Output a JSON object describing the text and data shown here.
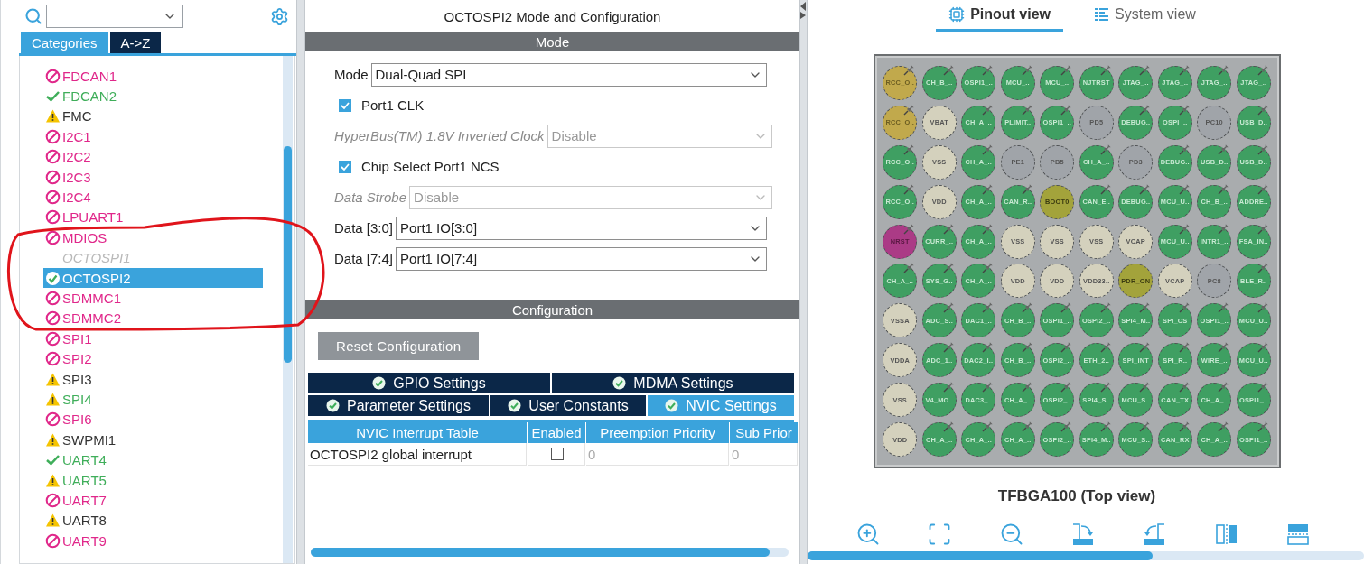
{
  "left_panel": {
    "tabs": [
      {
        "label": "Categories",
        "selected": true
      },
      {
        "label": "A->Z",
        "selected": false
      }
    ],
    "items": [
      {
        "label": "FDCAN1",
        "kind": "blocked",
        "selected": false
      },
      {
        "label": "FDCAN2",
        "kind": "configured",
        "selected": false
      },
      {
        "label": "FMC",
        "kind": "warning",
        "selected": false
      },
      {
        "label": "I2C1",
        "kind": "blocked",
        "selected": false
      },
      {
        "label": "I2C2",
        "kind": "blocked",
        "selected": false
      },
      {
        "label": "I2C3",
        "kind": "blocked",
        "selected": false
      },
      {
        "label": "I2C4",
        "kind": "blocked",
        "selected": false
      },
      {
        "label": "LPUART1",
        "kind": "blocked",
        "selected": false
      },
      {
        "label": "MDIOS",
        "kind": "blocked",
        "selected": false
      },
      {
        "label": "OCTOSPI1",
        "kind": "unavailable",
        "selected": false
      },
      {
        "label": "OCTOSPI2",
        "kind": "configured",
        "selected": true
      },
      {
        "label": "SDMMC1",
        "kind": "blocked",
        "selected": false
      },
      {
        "label": "SDMMC2",
        "kind": "blocked",
        "selected": false
      },
      {
        "label": "SPI1",
        "kind": "blocked",
        "selected": false
      },
      {
        "label": "SPI2",
        "kind": "blocked",
        "selected": false
      },
      {
        "label": "SPI3",
        "kind": "warning",
        "selected": false
      },
      {
        "label": "SPI4",
        "kind": "partial",
        "selected": false
      },
      {
        "label": "SPI6",
        "kind": "blocked",
        "selected": false
      },
      {
        "label": "SWPMI1",
        "kind": "warning",
        "selected": false
      },
      {
        "label": "UART4",
        "kind": "configured",
        "selected": false
      },
      {
        "label": "UART5",
        "kind": "partial",
        "selected": false
      },
      {
        "label": "UART7",
        "kind": "blocked",
        "selected": false
      },
      {
        "label": "UART8",
        "kind": "warning",
        "selected": false
      },
      {
        "label": "UART9",
        "kind": "blocked",
        "selected": false
      }
    ]
  },
  "middle_panel": {
    "title": "OCTOSPI2 Mode and Configuration",
    "mode_header": "Mode",
    "mode_fields": [
      {
        "kind": "select",
        "label": "Mode",
        "value": "Dual-Quad SPI",
        "disabled": false
      },
      {
        "kind": "checkbox",
        "label": "Port1 CLK",
        "checked": true
      },
      {
        "kind": "select",
        "label": "HyperBus(TM) 1.8V Inverted Clock",
        "value": "Disable",
        "disabled": true
      },
      {
        "kind": "checkbox",
        "label": "Chip Select Port1 NCS",
        "checked": true
      },
      {
        "kind": "select",
        "label": "Data Strobe",
        "value": "Disable",
        "disabled": true
      },
      {
        "kind": "select",
        "label": "Data [3:0]",
        "value": "Port1 IO[3:0]",
        "disabled": false
      },
      {
        "kind": "select",
        "label": "Data [7:4]",
        "value": "Port1 IO[7:4]",
        "disabled": false
      }
    ],
    "config_header": "Configuration",
    "reset_button": "Reset Configuration",
    "tab_rows": [
      [
        {
          "label": "GPIO Settings",
          "selected": false
        },
        {
          "label": "MDMA Settings",
          "selected": false
        }
      ],
      [
        {
          "label": "Parameter Settings",
          "selected": false
        },
        {
          "label": "User Constants",
          "selected": false
        },
        {
          "label": "NVIC Settings",
          "selected": true
        }
      ]
    ],
    "table": {
      "columns": [
        "NVIC Interrupt Table",
        "Enabled",
        "Preemption Priority",
        "Sub Prior"
      ],
      "rows": [
        {
          "name": "OCTOSPI2 global interrupt",
          "enabled": false,
          "preemption": "0",
          "sub_priority": "0"
        }
      ]
    }
  },
  "right_panel": {
    "view_tabs": [
      {
        "label": "Pinout view",
        "selected": true
      },
      {
        "label": "System view",
        "selected": false
      }
    ],
    "package": {
      "caption": "TFBGA100 (Top view)",
      "rows": [
        [
          {
            "label": "RCC_O..",
            "kind": "clock",
            "pinned": true
          },
          {
            "label": "CH_B_..",
            "kind": "signal",
            "pinned": true
          },
          {
            "label": "OSPI1_..",
            "kind": "signal",
            "pinned": true
          },
          {
            "label": "MCU_..",
            "kind": "signal",
            "pinned": true
          },
          {
            "label": "MCU_..",
            "kind": "signal",
            "pinned": true
          },
          {
            "label": "NJTRST",
            "kind": "signal",
            "pinned": true
          },
          {
            "label": "JTAG_..",
            "kind": "signal",
            "pinned": true
          },
          {
            "label": "JTAG_..",
            "kind": "signal",
            "pinned": true
          },
          {
            "label": "JTAG_..",
            "kind": "signal",
            "pinned": true
          },
          {
            "label": "JTAG_..",
            "kind": "signal",
            "pinned": true
          }
        ],
        [
          {
            "label": "RCC_O..",
            "kind": "clock",
            "pinned": true
          },
          {
            "label": "VBAT",
            "kind": "power",
            "pinned": false
          },
          {
            "label": "CH_A_..",
            "kind": "signal",
            "pinned": true
          },
          {
            "label": "PLIMIT..",
            "kind": "signal",
            "pinned": true
          },
          {
            "label": "OSPI1_..",
            "kind": "signal",
            "pinned": true
          },
          {
            "label": "PD5",
            "kind": "free",
            "pinned": false
          },
          {
            "label": "DEBUG..",
            "kind": "signal",
            "pinned": true
          },
          {
            "label": "OSPI_..",
            "kind": "signal",
            "pinned": true
          },
          {
            "label": "PC10",
            "kind": "free",
            "pinned": false
          },
          {
            "label": "USB_D..",
            "kind": "signal",
            "pinned": true
          }
        ],
        [
          {
            "label": "RCC_O..",
            "kind": "signal",
            "pinned": true
          },
          {
            "label": "VSS",
            "kind": "power",
            "pinned": false
          },
          {
            "label": "CH_A_..",
            "kind": "signal",
            "pinned": true
          },
          {
            "label": "PE1",
            "kind": "free",
            "pinned": false
          },
          {
            "label": "PB5",
            "kind": "free",
            "pinned": false
          },
          {
            "label": "CH_A_..",
            "kind": "signal",
            "pinned": true
          },
          {
            "label": "PD3",
            "kind": "free",
            "pinned": false
          },
          {
            "label": "DEBUG..",
            "kind": "signal",
            "pinned": true
          },
          {
            "label": "USB_D..",
            "kind": "signal",
            "pinned": true
          },
          {
            "label": "USB_D..",
            "kind": "signal",
            "pinned": true
          }
        ],
        [
          {
            "label": "RCC_O..",
            "kind": "signal",
            "pinned": true
          },
          {
            "label": "VDD",
            "kind": "power",
            "pinned": false
          },
          {
            "label": "CH_A_..",
            "kind": "signal",
            "pinned": true
          },
          {
            "label": "CAN_R..",
            "kind": "signal",
            "pinned": true
          },
          {
            "label": "BOOT0",
            "kind": "boot",
            "pinned": false
          },
          {
            "label": "CAN_E..",
            "kind": "signal",
            "pinned": true
          },
          {
            "label": "DEBUG..",
            "kind": "signal",
            "pinned": true
          },
          {
            "label": "MCU_U..",
            "kind": "signal",
            "pinned": true
          },
          {
            "label": "CH_B_..",
            "kind": "signal",
            "pinned": true
          },
          {
            "label": "ADDRE..",
            "kind": "signal",
            "pinned": true
          }
        ],
        [
          {
            "label": "NRST",
            "kind": "reset",
            "pinned": true
          },
          {
            "label": "CURR_..",
            "kind": "signal",
            "pinned": true
          },
          {
            "label": "CH_A_..",
            "kind": "signal",
            "pinned": true
          },
          {
            "label": "VSS",
            "kind": "power",
            "pinned": false
          },
          {
            "label": "VSS",
            "kind": "power",
            "pinned": false
          },
          {
            "label": "VSS",
            "kind": "power",
            "pinned": false
          },
          {
            "label": "VCAP",
            "kind": "power",
            "pinned": false
          },
          {
            "label": "MCU_U..",
            "kind": "signal",
            "pinned": true
          },
          {
            "label": "INTR1_..",
            "kind": "signal",
            "pinned": true
          },
          {
            "label": "FSA_IN..",
            "kind": "signal",
            "pinned": true
          }
        ],
        [
          {
            "label": "CH_A_..",
            "kind": "signal",
            "pinned": true
          },
          {
            "label": "SYS_G..",
            "kind": "signal",
            "pinned": true
          },
          {
            "label": "CH_A_..",
            "kind": "signal",
            "pinned": true
          },
          {
            "label": "VDD",
            "kind": "power",
            "pinned": false
          },
          {
            "label": "VDD",
            "kind": "power",
            "pinned": false
          },
          {
            "label": "VDD33..",
            "kind": "power",
            "pinned": false
          },
          {
            "label": "PDR_ON",
            "kind": "boot",
            "pinned": false
          },
          {
            "label": "VCAP",
            "kind": "power",
            "pinned": false
          },
          {
            "label": "PC8",
            "kind": "free",
            "pinned": false
          },
          {
            "label": "BLE_R..",
            "kind": "signal",
            "pinned": true
          }
        ],
        [
          {
            "label": "VSSA",
            "kind": "power",
            "pinned": false
          },
          {
            "label": "ADC_S..",
            "kind": "signal",
            "pinned": true
          },
          {
            "label": "DAC1_..",
            "kind": "signal",
            "pinned": true
          },
          {
            "label": "CH_B_..",
            "kind": "signal",
            "pinned": true
          },
          {
            "label": "OSPI1_..",
            "kind": "signal",
            "pinned": true
          },
          {
            "label": "OSPI2_..",
            "kind": "signal",
            "pinned": true
          },
          {
            "label": "SPI4_M..",
            "kind": "signal",
            "pinned": true
          },
          {
            "label": "SPI_CS",
            "kind": "signal",
            "pinned": true
          },
          {
            "label": "OSPI1_..",
            "kind": "signal",
            "pinned": true
          },
          {
            "label": "MCU_U..",
            "kind": "signal",
            "pinned": true
          }
        ],
        [
          {
            "label": "VDDA",
            "kind": "power",
            "pinned": false
          },
          {
            "label": "ADC_1..",
            "kind": "signal",
            "pinned": true
          },
          {
            "label": "DAC2_I..",
            "kind": "signal",
            "pinned": true
          },
          {
            "label": "CH_B_..",
            "kind": "signal",
            "pinned": true
          },
          {
            "label": "OSPI2_..",
            "kind": "signal",
            "pinned": true
          },
          {
            "label": "ETH_2..",
            "kind": "signal",
            "pinned": true
          },
          {
            "label": "SPI_INT",
            "kind": "signal",
            "pinned": true
          },
          {
            "label": "SPI_R..",
            "kind": "signal",
            "pinned": true
          },
          {
            "label": "WIRE_..",
            "kind": "signal",
            "pinned": true
          },
          {
            "label": "MCU_U..",
            "kind": "signal",
            "pinned": true
          }
        ],
        [
          {
            "label": "VSS",
            "kind": "power",
            "pinned": false
          },
          {
            "label": "V4_MO..",
            "kind": "signal",
            "pinned": true
          },
          {
            "label": "DAC3_..",
            "kind": "signal",
            "pinned": true
          },
          {
            "label": "CH_A_..",
            "kind": "signal",
            "pinned": true
          },
          {
            "label": "OSPI2_..",
            "kind": "signal",
            "pinned": true
          },
          {
            "label": "SPI4_S..",
            "kind": "signal",
            "pinned": true
          },
          {
            "label": "MCU_S..",
            "kind": "signal",
            "pinned": true
          },
          {
            "label": "CAN_TX",
            "kind": "signal",
            "pinned": true
          },
          {
            "label": "CH_A_..",
            "kind": "signal",
            "pinned": true
          },
          {
            "label": "OSPI1_..",
            "kind": "signal",
            "pinned": true
          }
        ],
        [
          {
            "label": "VDD",
            "kind": "power",
            "pinned": false
          },
          {
            "label": "CH_A_..",
            "kind": "signal",
            "pinned": true
          },
          {
            "label": "CH_A_..",
            "kind": "signal",
            "pinned": true
          },
          {
            "label": "CH_A_..",
            "kind": "signal",
            "pinned": true
          },
          {
            "label": "OSPI2_..",
            "kind": "signal",
            "pinned": true
          },
          {
            "label": "SPI4_M..",
            "kind": "signal",
            "pinned": true
          },
          {
            "label": "MCU_S..",
            "kind": "signal",
            "pinned": true
          },
          {
            "label": "CAN_RX",
            "kind": "signal",
            "pinned": true
          },
          {
            "label": "CH_A_..",
            "kind": "signal",
            "pinned": true
          },
          {
            "label": "OSPI1_..",
            "kind": "signal",
            "pinned": true
          }
        ]
      ]
    }
  }
}
